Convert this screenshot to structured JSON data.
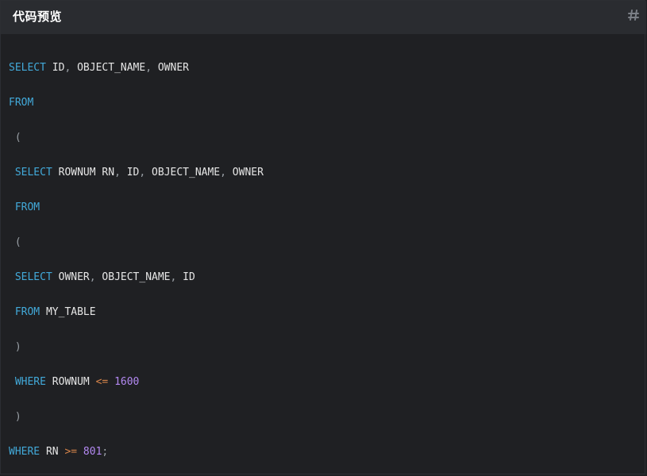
{
  "header": {
    "title": "代码预览",
    "corner_icon": "hash-icon"
  },
  "colors": {
    "keyword": "#42a9d9",
    "identifier": "#e6e6e6",
    "punctuation": "#9aa0a6",
    "operator": "#d7844a",
    "number": "#b389f2",
    "background": "#1f2023",
    "header_background": "#2a2c30"
  },
  "code": {
    "lines": [
      [
        {
          "t": "kw",
          "v": "SELECT"
        },
        {
          "t": "id",
          "v": " ID"
        },
        {
          "t": "punc",
          "v": ","
        },
        {
          "t": "id",
          "v": " OBJECT_NAME"
        },
        {
          "t": "punc",
          "v": ","
        },
        {
          "t": "id",
          "v": " OWNER"
        }
      ],
      [
        {
          "t": "kw",
          "v": "FROM"
        }
      ],
      [
        {
          "t": "punc",
          "v": " ("
        }
      ],
      [
        {
          "t": "kw",
          "v": " SELECT"
        },
        {
          "t": "id",
          "v": " ROWNUM RN"
        },
        {
          "t": "punc",
          "v": ","
        },
        {
          "t": "id",
          "v": " ID"
        },
        {
          "t": "punc",
          "v": ","
        },
        {
          "t": "id",
          "v": " OBJECT_NAME"
        },
        {
          "t": "punc",
          "v": ","
        },
        {
          "t": "id",
          "v": " OWNER"
        }
      ],
      [
        {
          "t": "kw",
          "v": " FROM"
        }
      ],
      [
        {
          "t": "punc",
          "v": " ("
        }
      ],
      [
        {
          "t": "kw",
          "v": " SELECT"
        },
        {
          "t": "id",
          "v": " OWNER"
        },
        {
          "t": "punc",
          "v": ","
        },
        {
          "t": "id",
          "v": " OBJECT_NAME"
        },
        {
          "t": "punc",
          "v": ","
        },
        {
          "t": "id",
          "v": " ID"
        }
      ],
      [
        {
          "t": "kw",
          "v": " FROM"
        },
        {
          "t": "id",
          "v": " MY_TABLE"
        }
      ],
      [
        {
          "t": "punc",
          "v": " )"
        }
      ],
      [
        {
          "t": "kw",
          "v": " WHERE"
        },
        {
          "t": "id",
          "v": " ROWNUM"
        },
        {
          "t": "op",
          "v": " <="
        },
        {
          "t": "num",
          "v": " 1600"
        }
      ],
      [
        {
          "t": "punc",
          "v": " )"
        }
      ],
      [
        {
          "t": "kw",
          "v": "WHERE"
        },
        {
          "t": "id",
          "v": " RN"
        },
        {
          "t": "op",
          "v": " >="
        },
        {
          "t": "num",
          "v": " 801"
        },
        {
          "t": "punc",
          "v": ";"
        }
      ]
    ]
  }
}
